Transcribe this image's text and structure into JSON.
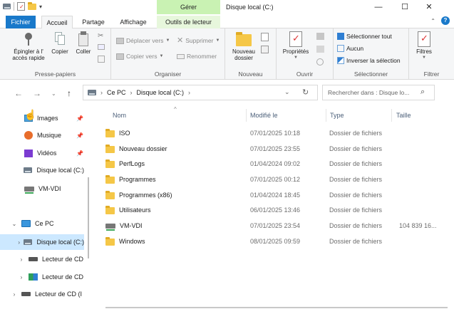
{
  "titlebar": {
    "manage_tab": "Gérer",
    "title": "Disque local (C:)",
    "minimize": "—",
    "maximize": "☐",
    "close": "✕"
  },
  "ribbon_tabs": {
    "file": "Fichier",
    "home": "Accueil",
    "share": "Partage",
    "view": "Affichage",
    "drive_tools": "Outils de lecteur"
  },
  "ribbon": {
    "clipboard": {
      "pin_label": "Épingler à l' accès rapide",
      "copy": "Copier",
      "paste": "Coller",
      "group": "Presse-papiers"
    },
    "organize": {
      "move_to": "Déplacer vers",
      "copy_to": "Copier vers",
      "delete": "Supprimer",
      "rename": "Renommer",
      "group": "Organiser"
    },
    "new": {
      "new_folder": "Nouveau dossier",
      "group": "Nouveau"
    },
    "open": {
      "properties": "Propriétés",
      "group": "Ouvrir"
    },
    "select": {
      "select_all": "Sélectionner tout",
      "select_none": "Aucun",
      "invert": "Inverser la sélection",
      "group": "Sélectionner"
    },
    "filter": {
      "filters": "Filtres",
      "group": "Filtrer"
    }
  },
  "address": {
    "crumb_1": "Ce PC",
    "crumb_2": "Disque local (C:)",
    "search_placeholder": "Rechercher dans : Disque lo..."
  },
  "navpane": {
    "quick": [
      {
        "label": "Images",
        "icon": "images-icon"
      },
      {
        "label": "Musique",
        "icon": "music-icon"
      },
      {
        "label": "Vidéos",
        "icon": "videos-icon"
      },
      {
        "label": "Disque local (C:)",
        "icon": "drive-icon"
      },
      {
        "label": "VM-VDI",
        "icon": "network-drive-icon"
      }
    ],
    "this_pc": "Ce PC",
    "drives": [
      {
        "label": "Disque local (C:)",
        "selected": true
      },
      {
        "label": "Lecteur de CD"
      },
      {
        "label": "Lecteur de CD"
      },
      {
        "label": "Lecteur de CD (I"
      }
    ]
  },
  "columns": {
    "name": "Nom",
    "modified": "Modifié le",
    "type": "Type",
    "size": "Taille"
  },
  "files": [
    {
      "name": "ISO",
      "date": "07/01/2025 10:18",
      "type": "Dossier de fichiers",
      "size": ""
    },
    {
      "name": "Nouveau dossier",
      "date": "07/01/2025 23:55",
      "type": "Dossier de fichiers",
      "size": ""
    },
    {
      "name": "PerfLogs",
      "date": "01/04/2024 09:02",
      "type": "Dossier de fichiers",
      "size": ""
    },
    {
      "name": "Programmes",
      "date": "07/01/2025 00:12",
      "type": "Dossier de fichiers",
      "size": ""
    },
    {
      "name": "Programmes (x86)",
      "date": "01/04/2024 18:45",
      "type": "Dossier de fichiers",
      "size": ""
    },
    {
      "name": "Utilisateurs",
      "date": "06/01/2025 13:46",
      "type": "Dossier de fichiers",
      "size": ""
    },
    {
      "name": "VM-VDI",
      "date": "07/01/2025 23:54",
      "type": "Dossier de fichiers",
      "size": "104 839 16..."
    },
    {
      "name": "Windows",
      "date": "08/01/2025 09:59",
      "type": "Dossier de fichiers",
      "size": ""
    }
  ]
}
